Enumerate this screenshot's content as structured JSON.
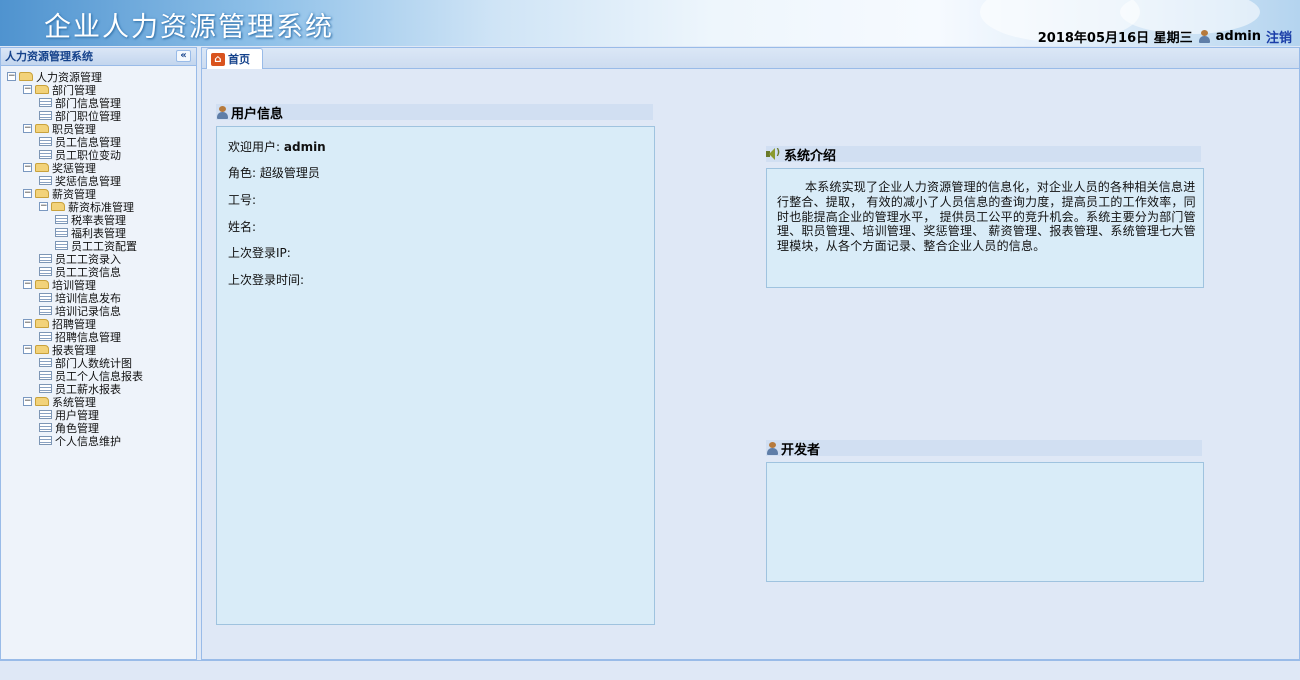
{
  "header": {
    "app_title": "企业人力资源管理系统",
    "date_text": "2018年05月16日 星期三",
    "username": "admin",
    "logout_label": "注销"
  },
  "sidebar": {
    "title": "人力资源管理系统",
    "collapse_label": "«",
    "tree": [
      {
        "label": "人力资源管理",
        "type": "folder",
        "level": 0
      },
      {
        "label": "部门管理",
        "type": "folder",
        "level": 1
      },
      {
        "label": "部门信息管理",
        "type": "file",
        "level": 2
      },
      {
        "label": "部门职位管理",
        "type": "file",
        "level": 2
      },
      {
        "label": "职员管理",
        "type": "folder",
        "level": 1
      },
      {
        "label": "员工信息管理",
        "type": "file",
        "level": 2
      },
      {
        "label": "员工职位变动",
        "type": "file",
        "level": 2
      },
      {
        "label": "奖惩管理",
        "type": "folder",
        "level": 1
      },
      {
        "label": "奖惩信息管理",
        "type": "file",
        "level": 2
      },
      {
        "label": "薪资管理",
        "type": "folder",
        "level": 1
      },
      {
        "label": "薪资标准管理",
        "type": "folder",
        "level": 2
      },
      {
        "label": "税率表管理",
        "type": "file",
        "level": 3
      },
      {
        "label": "福利表管理",
        "type": "file",
        "level": 3
      },
      {
        "label": "员工工资配置",
        "type": "file",
        "level": 3
      },
      {
        "label": "员工工资录入",
        "type": "file",
        "level": 2
      },
      {
        "label": "员工工资信息",
        "type": "file",
        "level": 2
      },
      {
        "label": "培训管理",
        "type": "folder",
        "level": 1
      },
      {
        "label": "培训信息发布",
        "type": "file",
        "level": 2
      },
      {
        "label": "培训记录信息",
        "type": "file",
        "level": 2
      },
      {
        "label": "招聘管理",
        "type": "folder",
        "level": 1
      },
      {
        "label": "招聘信息管理",
        "type": "file",
        "level": 2
      },
      {
        "label": "报表管理",
        "type": "folder",
        "level": 1
      },
      {
        "label": "部门人数统计图",
        "type": "file",
        "level": 2
      },
      {
        "label": "员工个人信息报表",
        "type": "file",
        "level": 2
      },
      {
        "label": "员工薪水报表",
        "type": "file",
        "level": 2
      },
      {
        "label": "系统管理",
        "type": "folder",
        "level": 1
      },
      {
        "label": "用户管理",
        "type": "file",
        "level": 2
      },
      {
        "label": "角色管理",
        "type": "file",
        "level": 2
      },
      {
        "label": "个人信息维护",
        "type": "file",
        "level": 2
      }
    ]
  },
  "tabs": [
    {
      "label": "首页"
    }
  ],
  "user_info": {
    "title": "用户信息",
    "welcome_label": "欢迎用户:",
    "welcome_value": "admin",
    "role_label": "角色:",
    "role_value": "超级管理员",
    "id_label": "工号:",
    "name_label": "姓名:",
    "last_ip_label": "上次登录IP:",
    "last_time_label": "上次登录时间:"
  },
  "intro": {
    "title": "系统介绍",
    "text": "本系统实现了企业人力资源管理的信息化，对企业人员的各种相关信息进行整合、提取， 有效的减小了人员信息的查询力度，提高员工的工作效率，同时也能提高企业的管理水平， 提供员工公平的竞升机会。系统主要分为部门管理、职员管理、培训管理、奖惩管理、 薪资管理、报表管理、系统管理七大管理模块，从各个方面记录、整合企业人员的信息。"
  },
  "developer": {
    "title": "开发者"
  }
}
